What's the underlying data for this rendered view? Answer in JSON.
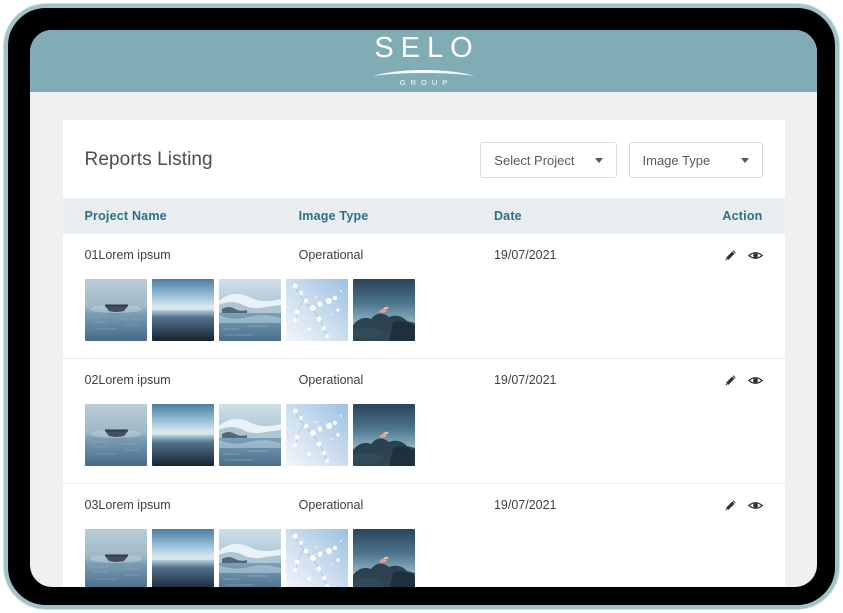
{
  "brand": {
    "name": "SELO",
    "tagline": "GROUP",
    "header_color": "#80adb5"
  },
  "card": {
    "title": "Reports Listing",
    "filters": [
      {
        "name": "select-project",
        "label": "Select Project"
      },
      {
        "name": "image-type",
        "label": "Image Type"
      }
    ]
  },
  "table": {
    "columns": [
      {
        "key": "project_name",
        "label": "Project Name"
      },
      {
        "key": "image_type",
        "label": "Image Type"
      },
      {
        "key": "date",
        "label": "Date"
      },
      {
        "key": "action",
        "label": "Action"
      }
    ],
    "header_text_color": "#2f6f85",
    "rows": [
      {
        "project_name": "01Lorem ipsum",
        "image_type": "Operational",
        "date": "19/07/2021",
        "thumbnails": [
          "boat-on-misty-water",
          "blue-horizon-gradient",
          "snowy-cliff-reflection",
          "white-blossom-branches",
          "dark-mountain-pink-clouds"
        ],
        "actions": [
          "edit-icon",
          "view-icon"
        ]
      },
      {
        "project_name": "02Lorem ipsum",
        "image_type": "Operational",
        "date": "19/07/2021",
        "thumbnails": [
          "boat-on-misty-water",
          "blue-horizon-gradient",
          "snowy-cliff-reflection",
          "white-blossom-branches",
          "dark-mountain-pink-clouds"
        ],
        "actions": [
          "edit-icon",
          "view-icon"
        ]
      },
      {
        "project_name": "03Lorem ipsum",
        "image_type": "Operational",
        "date": "19/07/2021",
        "thumbnails": [
          "boat-on-misty-water",
          "blue-horizon-gradient",
          "snowy-cliff-reflection",
          "white-blossom-branches",
          "dark-mountain-pink-clouds"
        ],
        "actions": [
          "edit-icon",
          "view-icon"
        ]
      }
    ]
  }
}
